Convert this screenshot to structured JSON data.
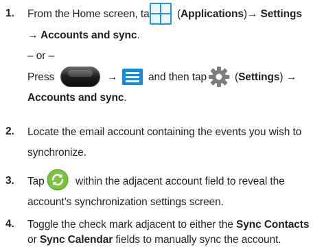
{
  "steps": [
    {
      "number": "1.",
      "line1_prefix": "From the Home screen, tap",
      "line1_paren_open": "(",
      "line1_bold_1": "Applications",
      "line1_mid": ")→ ",
      "line1_bold_2": "Settings",
      "line2_bold": "→ Accounts and sync",
      "line2_suffix": ".",
      "or_text": "– or –",
      "alt_prefix": "Press",
      "alt_arrow_1": "→",
      "alt_and_then_tap": "and then tap",
      "alt_paren_open": "(",
      "alt_bold": "Settings",
      "alt_suffix": ") →",
      "alt_line2_bold": "Accounts and sync",
      "alt_line2_suffix": "."
    },
    {
      "number": "2.",
      "line1": "Locate the email account containing the events you wish to",
      "line2": "synchronize."
    },
    {
      "number": "3.",
      "line1_prefix": "Tap",
      "line1_suffix": "within the adjacent account field to reveal the",
      "line2": "account’s synchronization settings screen."
    },
    {
      "number": "4.",
      "line1_prefix": "Toggle the check mark adjacent to either the",
      "line1_bold": "Sync Contacts",
      "line2_prefix": "or",
      "line2_bold": "Sync Calendar",
      "line2_suffix": "fields to manually sync the account."
    }
  ],
  "icons": {
    "applications": "applications-grid-icon",
    "home_key": "home-key-icon",
    "menu_key": "menu-key-icon",
    "settings": "settings-gear-icon",
    "sync": "sync-arrows-icon"
  },
  "colors": {
    "text": "#231f20",
    "applications_blue": "#2d8fd5",
    "menu_blue": "#1b8ad3",
    "settings_gray": "#7d7d7d",
    "sync_green": "#7cc242"
  }
}
